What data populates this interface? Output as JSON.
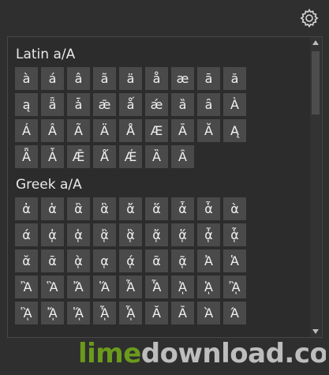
{
  "settings_icon": "gear-icon",
  "sections": [
    {
      "title": "Latin a/A",
      "chars": [
        "à",
        "á",
        "â",
        "ã",
        "ä",
        "å",
        "æ",
        "ā",
        "ă",
        "ą",
        "ǟ",
        "ǡ",
        "ǣ",
        "ǻ",
        "ǽ",
        "ȁ",
        "ȃ",
        "À",
        "Á",
        "Â",
        "Ã",
        "Ä",
        "Å",
        "Æ",
        "Ā",
        "Ă",
        "Ą",
        "Ǟ",
        "Ǡ",
        "Ǣ",
        "Ǻ",
        "Ǽ",
        "Ȁ",
        "Ȃ"
      ]
    },
    {
      "title": "Greek a/A",
      "chars": [
        "ἀ",
        "ἁ",
        "ἂ",
        "ἃ",
        "ἄ",
        "ἅ",
        "ἆ",
        "ἇ",
        "ὰ",
        "ά",
        "ᾀ",
        "ᾁ",
        "ᾂ",
        "ᾃ",
        "ᾄ",
        "ᾅ",
        "ᾆ",
        "ᾇ",
        "ᾰ",
        "ᾱ",
        "ᾲ",
        "ᾳ",
        "ᾴ",
        "ᾶ",
        "ᾷ",
        "Ἀ",
        "Ἁ",
        "Ἂ",
        "Ἃ",
        "Ἄ",
        "Ἅ",
        "Ἆ",
        "Ἇ",
        "ᾈ",
        "ᾉ",
        "ᾊ",
        "ᾋ",
        "ᾌ",
        "ᾍ",
        "ᾎ",
        "ᾏ",
        "Ᾰ",
        "Ᾱ",
        "Ὰ",
        "Ά"
      ]
    }
  ],
  "watermark": "limedownload.com",
  "colors": {
    "background": "#2f2f2f",
    "button": "#4a4a4a",
    "watermark_green": "#6b9a1c",
    "watermark_gray": "#bdbdbd"
  }
}
